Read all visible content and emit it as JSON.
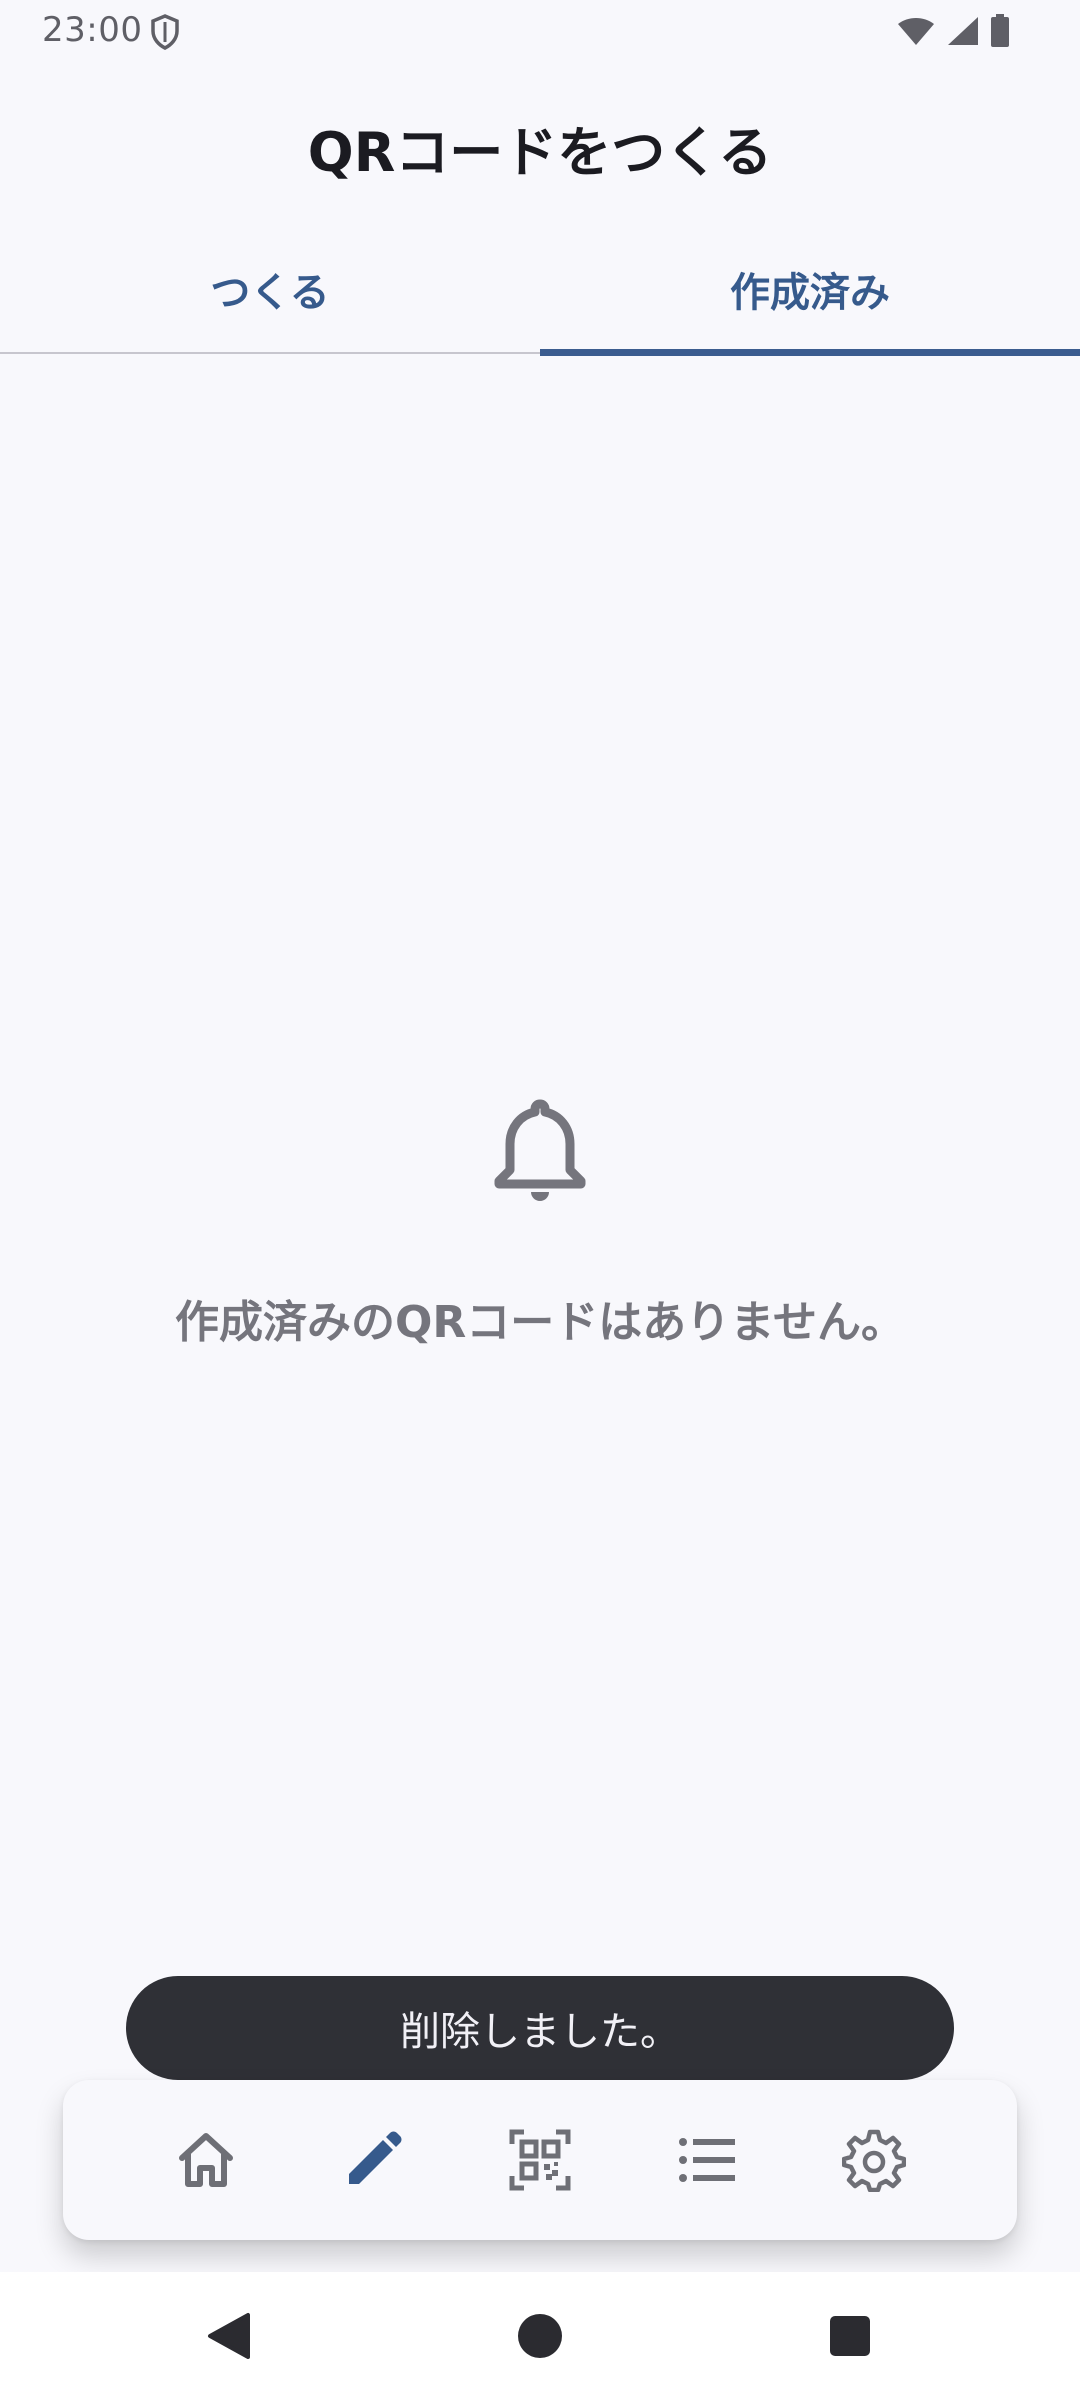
{
  "status_bar": {
    "time": "23:00"
  },
  "app": {
    "title": "QRコードをつくる"
  },
  "tabs": [
    {
      "label": "つくる",
      "selected": false
    },
    {
      "label": "作成済み",
      "selected": true
    }
  ],
  "empty_state": {
    "icon": "bell-icon",
    "message": "作成済みのQRコードはありません。"
  },
  "snackbar": {
    "message": "削除しました。"
  },
  "bottom_nav": {
    "items": [
      {
        "icon": "home-icon",
        "selected": false
      },
      {
        "icon": "pencil-icon",
        "selected": true
      },
      {
        "icon": "qr-code-icon",
        "selected": false
      },
      {
        "icon": "list-icon",
        "selected": false
      },
      {
        "icon": "gear-icon",
        "selected": false
      }
    ]
  },
  "system_nav": {
    "icons": [
      "back-icon",
      "home-circle-icon",
      "recents-icon"
    ]
  },
  "colors": {
    "accent": "#3b5c8f",
    "background": "#f8f8fc",
    "muted": "#75757d",
    "snackbar": "#2f3036"
  }
}
